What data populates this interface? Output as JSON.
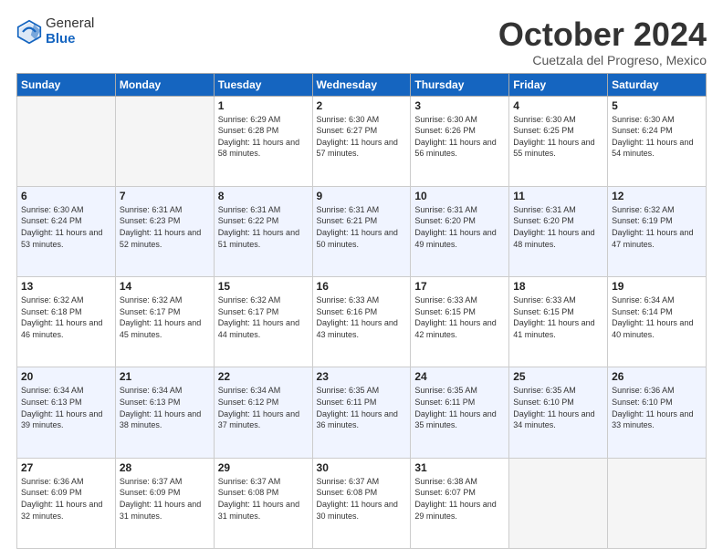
{
  "header": {
    "logo_line1": "General",
    "logo_line2": "Blue",
    "month": "October 2024",
    "location": "Cuetzala del Progreso, Mexico"
  },
  "days_of_week": [
    "Sunday",
    "Monday",
    "Tuesday",
    "Wednesday",
    "Thursday",
    "Friday",
    "Saturday"
  ],
  "weeks": [
    [
      {
        "num": "",
        "sunrise": "",
        "sunset": "",
        "daylight": ""
      },
      {
        "num": "",
        "sunrise": "",
        "sunset": "",
        "daylight": ""
      },
      {
        "num": "1",
        "sunrise": "Sunrise: 6:29 AM",
        "sunset": "Sunset: 6:28 PM",
        "daylight": "Daylight: 11 hours and 58 minutes."
      },
      {
        "num": "2",
        "sunrise": "Sunrise: 6:30 AM",
        "sunset": "Sunset: 6:27 PM",
        "daylight": "Daylight: 11 hours and 57 minutes."
      },
      {
        "num": "3",
        "sunrise": "Sunrise: 6:30 AM",
        "sunset": "Sunset: 6:26 PM",
        "daylight": "Daylight: 11 hours and 56 minutes."
      },
      {
        "num": "4",
        "sunrise": "Sunrise: 6:30 AM",
        "sunset": "Sunset: 6:25 PM",
        "daylight": "Daylight: 11 hours and 55 minutes."
      },
      {
        "num": "5",
        "sunrise": "Sunrise: 6:30 AM",
        "sunset": "Sunset: 6:24 PM",
        "daylight": "Daylight: 11 hours and 54 minutes."
      }
    ],
    [
      {
        "num": "6",
        "sunrise": "Sunrise: 6:30 AM",
        "sunset": "Sunset: 6:24 PM",
        "daylight": "Daylight: 11 hours and 53 minutes."
      },
      {
        "num": "7",
        "sunrise": "Sunrise: 6:31 AM",
        "sunset": "Sunset: 6:23 PM",
        "daylight": "Daylight: 11 hours and 52 minutes."
      },
      {
        "num": "8",
        "sunrise": "Sunrise: 6:31 AM",
        "sunset": "Sunset: 6:22 PM",
        "daylight": "Daylight: 11 hours and 51 minutes."
      },
      {
        "num": "9",
        "sunrise": "Sunrise: 6:31 AM",
        "sunset": "Sunset: 6:21 PM",
        "daylight": "Daylight: 11 hours and 50 minutes."
      },
      {
        "num": "10",
        "sunrise": "Sunrise: 6:31 AM",
        "sunset": "Sunset: 6:20 PM",
        "daylight": "Daylight: 11 hours and 49 minutes."
      },
      {
        "num": "11",
        "sunrise": "Sunrise: 6:31 AM",
        "sunset": "Sunset: 6:20 PM",
        "daylight": "Daylight: 11 hours and 48 minutes."
      },
      {
        "num": "12",
        "sunrise": "Sunrise: 6:32 AM",
        "sunset": "Sunset: 6:19 PM",
        "daylight": "Daylight: 11 hours and 47 minutes."
      }
    ],
    [
      {
        "num": "13",
        "sunrise": "Sunrise: 6:32 AM",
        "sunset": "Sunset: 6:18 PM",
        "daylight": "Daylight: 11 hours and 46 minutes."
      },
      {
        "num": "14",
        "sunrise": "Sunrise: 6:32 AM",
        "sunset": "Sunset: 6:17 PM",
        "daylight": "Daylight: 11 hours and 45 minutes."
      },
      {
        "num": "15",
        "sunrise": "Sunrise: 6:32 AM",
        "sunset": "Sunset: 6:17 PM",
        "daylight": "Daylight: 11 hours and 44 minutes."
      },
      {
        "num": "16",
        "sunrise": "Sunrise: 6:33 AM",
        "sunset": "Sunset: 6:16 PM",
        "daylight": "Daylight: 11 hours and 43 minutes."
      },
      {
        "num": "17",
        "sunrise": "Sunrise: 6:33 AM",
        "sunset": "Sunset: 6:15 PM",
        "daylight": "Daylight: 11 hours and 42 minutes."
      },
      {
        "num": "18",
        "sunrise": "Sunrise: 6:33 AM",
        "sunset": "Sunset: 6:15 PM",
        "daylight": "Daylight: 11 hours and 41 minutes."
      },
      {
        "num": "19",
        "sunrise": "Sunrise: 6:34 AM",
        "sunset": "Sunset: 6:14 PM",
        "daylight": "Daylight: 11 hours and 40 minutes."
      }
    ],
    [
      {
        "num": "20",
        "sunrise": "Sunrise: 6:34 AM",
        "sunset": "Sunset: 6:13 PM",
        "daylight": "Daylight: 11 hours and 39 minutes."
      },
      {
        "num": "21",
        "sunrise": "Sunrise: 6:34 AM",
        "sunset": "Sunset: 6:13 PM",
        "daylight": "Daylight: 11 hours and 38 minutes."
      },
      {
        "num": "22",
        "sunrise": "Sunrise: 6:34 AM",
        "sunset": "Sunset: 6:12 PM",
        "daylight": "Daylight: 11 hours and 37 minutes."
      },
      {
        "num": "23",
        "sunrise": "Sunrise: 6:35 AM",
        "sunset": "Sunset: 6:11 PM",
        "daylight": "Daylight: 11 hours and 36 minutes."
      },
      {
        "num": "24",
        "sunrise": "Sunrise: 6:35 AM",
        "sunset": "Sunset: 6:11 PM",
        "daylight": "Daylight: 11 hours and 35 minutes."
      },
      {
        "num": "25",
        "sunrise": "Sunrise: 6:35 AM",
        "sunset": "Sunset: 6:10 PM",
        "daylight": "Daylight: 11 hours and 34 minutes."
      },
      {
        "num": "26",
        "sunrise": "Sunrise: 6:36 AM",
        "sunset": "Sunset: 6:10 PM",
        "daylight": "Daylight: 11 hours and 33 minutes."
      }
    ],
    [
      {
        "num": "27",
        "sunrise": "Sunrise: 6:36 AM",
        "sunset": "Sunset: 6:09 PM",
        "daylight": "Daylight: 11 hours and 32 minutes."
      },
      {
        "num": "28",
        "sunrise": "Sunrise: 6:37 AM",
        "sunset": "Sunset: 6:09 PM",
        "daylight": "Daylight: 11 hours and 31 minutes."
      },
      {
        "num": "29",
        "sunrise": "Sunrise: 6:37 AM",
        "sunset": "Sunset: 6:08 PM",
        "daylight": "Daylight: 11 hours and 31 minutes."
      },
      {
        "num": "30",
        "sunrise": "Sunrise: 6:37 AM",
        "sunset": "Sunset: 6:08 PM",
        "daylight": "Daylight: 11 hours and 30 minutes."
      },
      {
        "num": "31",
        "sunrise": "Sunrise: 6:38 AM",
        "sunset": "Sunset: 6:07 PM",
        "daylight": "Daylight: 11 hours and 29 minutes."
      },
      {
        "num": "",
        "sunrise": "",
        "sunset": "",
        "daylight": ""
      },
      {
        "num": "",
        "sunrise": "",
        "sunset": "",
        "daylight": ""
      }
    ]
  ]
}
